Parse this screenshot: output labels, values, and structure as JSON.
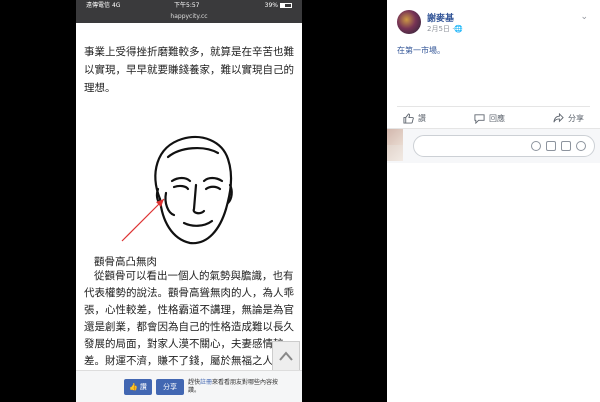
{
  "phone": {
    "status": {
      "carrier": "遠傳電信",
      "network": "4G",
      "time": "下午5:57",
      "battery": "39%"
    },
    "url": "happycity.cc",
    "article": {
      "para1": "事業上受得挫折磨難較多，就算是在辛苦也難以實現，早早就要賺錢養家，難以實現自己的理想。",
      "heading": "顴骨高凸無肉",
      "para2": "從顴骨可以看出一個人的氣勢與膽識，也有代表權勢的說法。顴骨高聳無肉的人，為人乖張，心性較差，性格霸道不講理，無論是為官還是創業，都會因為自己的性格造成難以長久發展的局面，對家人漠不關心，夫妻感情較差。財運不濟，賺不了錢，屬於無福之人。"
    },
    "bottom": {
      "like_label": "讚",
      "share_label": "分享",
      "signup_pre": "趕快",
      "signup_link": "註冊",
      "signup_post": "來看看朋友對哪些內容按讚。"
    }
  },
  "fb": {
    "poster": "謝麥基",
    "date": "2月5日",
    "location": "在第一市場。",
    "actions": {
      "like": "讚",
      "comment": "回應",
      "share": "分享"
    }
  },
  "colors": {
    "fb_blue": "#4267b2",
    "link": "#365899",
    "status_bg": "#3a3a3c"
  }
}
